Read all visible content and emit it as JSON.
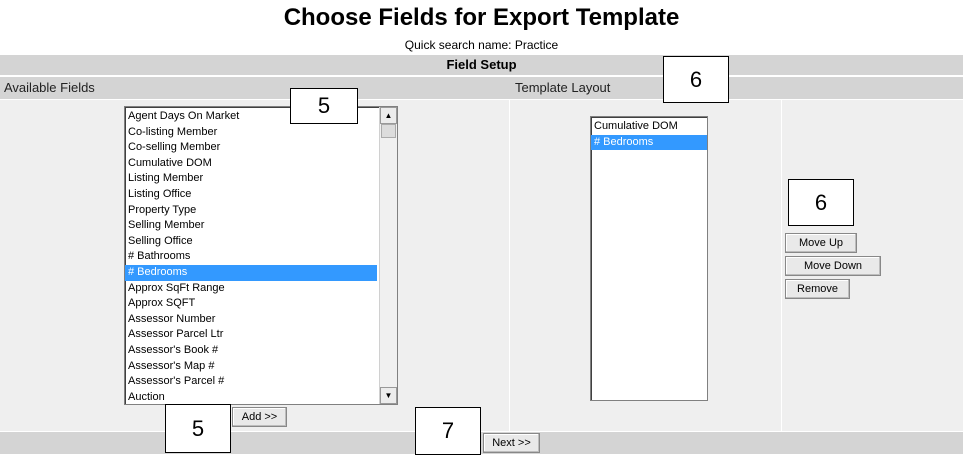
{
  "page": {
    "title": "Choose Fields for Export Template",
    "subtitle": "Quick search name: Practice",
    "section_title": "Field Setup"
  },
  "available": {
    "header": "Available Fields",
    "items": [
      {
        "label": "Agent Days On Market",
        "selected": false
      },
      {
        "label": "Co-listing Member",
        "selected": false
      },
      {
        "label": "Co-selling Member",
        "selected": false
      },
      {
        "label": "Cumulative DOM",
        "selected": false
      },
      {
        "label": "Listing Member",
        "selected": false
      },
      {
        "label": "Listing Office",
        "selected": false
      },
      {
        "label": "Property Type",
        "selected": false
      },
      {
        "label": "Selling Member",
        "selected": false
      },
      {
        "label": "Selling Office",
        "selected": false
      },
      {
        "label": "# Bathrooms",
        "selected": false
      },
      {
        "label": "# Bedrooms",
        "selected": true
      },
      {
        "label": "Approx SqFt Range",
        "selected": false
      },
      {
        "label": "Approx SQFT",
        "selected": false
      },
      {
        "label": "Assessor Number",
        "selected": false
      },
      {
        "label": "Assessor Parcel Ltr",
        "selected": false
      },
      {
        "label": "Assessor's Book #",
        "selected": false
      },
      {
        "label": "Assessor's Map #",
        "selected": false
      },
      {
        "label": "Assessor's Parcel #",
        "selected": false
      },
      {
        "label": "Auction",
        "selected": false
      }
    ],
    "add_label": "Add >>"
  },
  "template": {
    "header": "Template Layout",
    "items": [
      {
        "label": "Cumulative DOM",
        "selected": false
      },
      {
        "label": "# Bedrooms",
        "selected": true
      }
    ]
  },
  "actions": {
    "move_up": "Move Up",
    "move_down": "Move Down",
    "remove": "Remove"
  },
  "footer": {
    "next_label": "Next >>"
  },
  "callouts": {
    "available_list": "5",
    "template_header": "6",
    "actions": "6",
    "add": "5",
    "next": "7"
  },
  "icons": {
    "scroll_up": "scroll-up-arrow-icon",
    "scroll_down": "scroll-down-arrow-icon"
  }
}
